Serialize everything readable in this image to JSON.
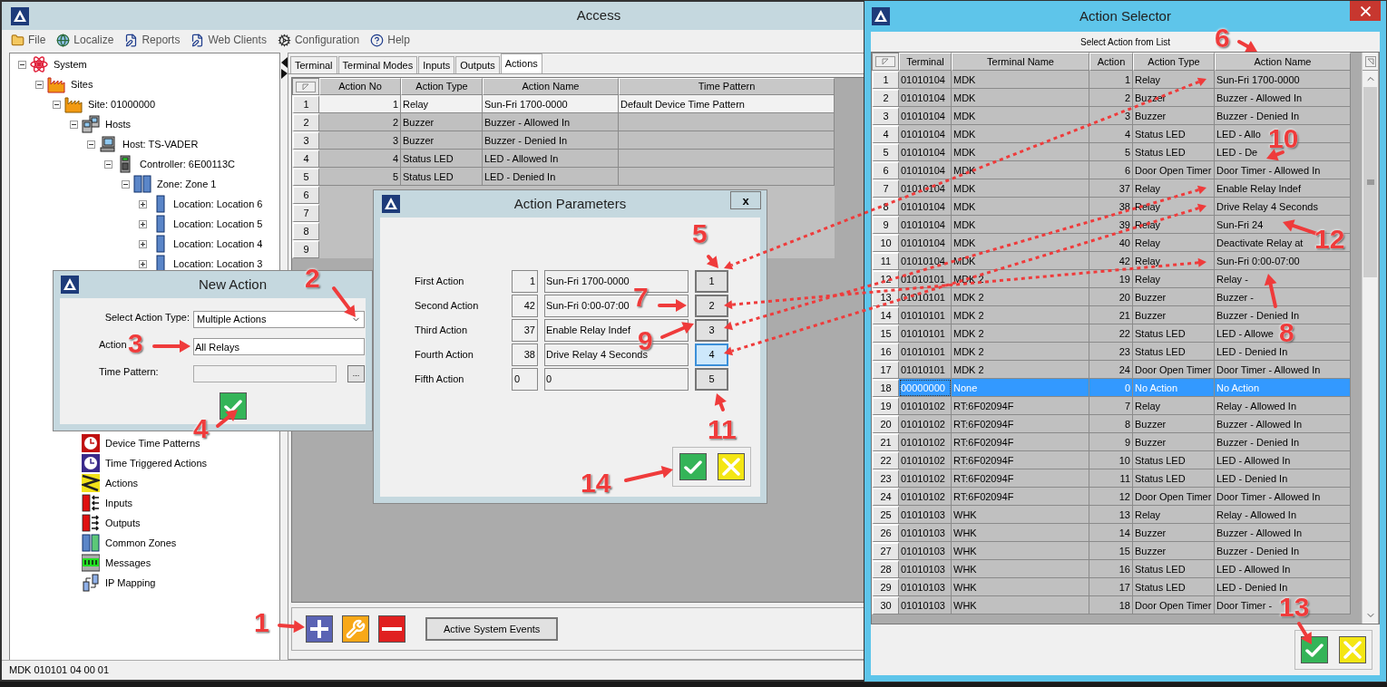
{
  "window": {
    "title": "Access"
  },
  "menu": [
    {
      "label": "File",
      "kind": "folder"
    },
    {
      "label": "Localize",
      "kind": "globe"
    },
    {
      "label": "Reports",
      "kind": "edit"
    },
    {
      "label": "Web Clients",
      "kind": "edit"
    },
    {
      "label": "Configuration",
      "kind": "gears"
    },
    {
      "label": "Help",
      "kind": "help"
    }
  ],
  "tree": [
    {
      "label": "System",
      "kind": "system",
      "expanded": true,
      "children": [
        {
          "label": "Sites",
          "kind": "sites",
          "expanded": true,
          "children": [
            {
              "label": "Site: 01000000",
              "kind": "site",
              "expanded": true,
              "children": [
                {
                  "label": "Hosts",
                  "kind": "hosts",
                  "expanded": true,
                  "children": [
                    {
                      "label": "Host: TS-VADER",
                      "kind": "host",
                      "expanded": true,
                      "children": [
                        {
                          "label": "Controller: 6E00113C",
                          "kind": "controller",
                          "expanded": true,
                          "children": [
                            {
                              "label": "Zone: Zone 1",
                              "kind": "zone",
                              "expanded": true,
                              "children": [
                                {
                                  "label": "Location: Location 6",
                                  "kind": "location",
                                  "expanded": false
                                },
                                {
                                  "label": "Location: Location 5",
                                  "kind": "location",
                                  "expanded": false
                                },
                                {
                                  "label": "Location: Location 4",
                                  "kind": "location",
                                  "expanded": false
                                },
                                {
                                  "label": "Location: Location 3",
                                  "kind": "location",
                                  "expanded": false
                                }
                              ]
                            }
                          ]
                        }
                      ]
                    }
                  ]
                },
                {
                  "label": "Device Time Patterns",
                  "kind": "schedule"
                },
                {
                  "label": "Time Triggered Actions",
                  "kind": "timer"
                },
                {
                  "label": "Actions",
                  "kind": "actions"
                },
                {
                  "label": "Inputs",
                  "kind": "inputs"
                },
                {
                  "label": "Outputs",
                  "kind": "outputs"
                },
                {
                  "label": "Common Zones",
                  "kind": "zones"
                },
                {
                  "label": "Messages",
                  "kind": "messages"
                },
                {
                  "label": "IP Mapping",
                  "kind": "mapping"
                }
              ]
            }
          ]
        }
      ]
    }
  ],
  "tabs": [
    {
      "label": "Terminal",
      "selected": false
    },
    {
      "label": "Terminal Modes",
      "selected": false
    },
    {
      "label": "Inputs",
      "selected": false
    },
    {
      "label": "Outputs",
      "selected": false
    },
    {
      "label": "Actions",
      "selected": true
    }
  ],
  "actions_table": {
    "columns": [
      "Action No",
      "Action Type",
      "Action Name",
      "Time Pattern"
    ],
    "rows": [
      {
        "no": "1",
        "selected": true,
        "cells": [
          "1",
          "Relay",
          "Sun-Fri 1700-0000",
          "Default Device Time Pattern"
        ]
      },
      {
        "no": "2",
        "selected": false,
        "cells": [
          "2",
          "Buzzer",
          "Buzzer - Allowed In"
        ]
      },
      {
        "no": "3",
        "selected": false,
        "cells": [
          "3",
          "Buzzer",
          "Buzzer - Denied In"
        ]
      },
      {
        "no": "4",
        "selected": false,
        "cells": [
          "4",
          "Status LED",
          "LED - Allowed In"
        ]
      },
      {
        "no": "5",
        "selected": false,
        "cells": [
          "5",
          "Status LED",
          "LED - Denied In"
        ]
      },
      {
        "no": "6",
        "selected": false
      },
      {
        "no": "7",
        "selected": false
      },
      {
        "no": "8",
        "selected": false
      },
      {
        "no": "9",
        "selected": false
      }
    ]
  },
  "toolbar": {
    "events_button": "Active System Events"
  },
  "status_bar": "MDK 010101 04 00 01",
  "new_action": {
    "title": "New Action",
    "type_label": "Select Action Type:",
    "type_value": "Multiple Actions",
    "name_label": "Action",
    "name_value": "All Relays",
    "pattern_label": "Time Pattern:",
    "browse": "..."
  },
  "action_parameters": {
    "title": "Action Parameters",
    "close": "x",
    "slots": [
      {
        "label": "First Action",
        "number": "1",
        "name": "Sun-Fri 1700-0000",
        "button": "1",
        "selected": false
      },
      {
        "label": "Second Action",
        "number": "42",
        "name": "Sun-Fri 0:00-07:00",
        "button": "2",
        "selected": false
      },
      {
        "label": "Third Action",
        "number": "37",
        "name": "Enable Relay Indef",
        "button": "3",
        "selected": false
      },
      {
        "label": "Fourth Action",
        "number": "38",
        "name": "Drive Relay 4 Seconds",
        "button": "4",
        "selected": true
      },
      {
        "label": "Fifth Action",
        "number": "0",
        "name": "0",
        "button": "5",
        "selected": false
      }
    ]
  },
  "action_selector": {
    "title": "Action Selector",
    "subtitle": "Select Action from List",
    "columns": [
      "Terminal",
      "Terminal Name",
      "Action",
      "Action Type",
      "Action Name"
    ],
    "rows": [
      {
        "no": "1",
        "selected": false,
        "cells": [
          "01010104",
          "MDK",
          "1",
          "Relay",
          "Sun-Fri 1700-0000"
        ]
      },
      {
        "no": "2",
        "selected": false,
        "cells": [
          "01010104",
          "MDK",
          "2",
          "Buzzer",
          "Buzzer - Allowed In"
        ]
      },
      {
        "no": "3",
        "selected": false,
        "cells": [
          "01010104",
          "MDK",
          "3",
          "Buzzer",
          "Buzzer - Denied In"
        ]
      },
      {
        "no": "4",
        "selected": false,
        "cells": [
          "01010104",
          "MDK",
          "4",
          "Status LED",
          "LED - Allo"
        ]
      },
      {
        "no": "5",
        "selected": false,
        "cells": [
          "01010104",
          "MDK",
          "5",
          "Status LED",
          "LED - De"
        ]
      },
      {
        "no": "6",
        "selected": false,
        "cells": [
          "01010104",
          "MDK",
          "6",
          "Door Open Timer",
          "Door Timer - Allowed In"
        ]
      },
      {
        "no": "7",
        "selected": false,
        "cells": [
          "01010104",
          "MDK",
          "37",
          "Relay",
          "Enable Relay Indef"
        ]
      },
      {
        "no": "8",
        "selected": false,
        "cells": [
          "01010104",
          "MDK",
          "38",
          "Relay",
          "Drive Relay 4 Seconds"
        ]
      },
      {
        "no": "9",
        "selected": false,
        "cells": [
          "01010104",
          "MDK",
          "39",
          "Relay",
          "Sun-Fri 24"
        ]
      },
      {
        "no": "10",
        "selected": false,
        "cells": [
          "01010104",
          "MDK",
          "40",
          "Relay",
          "Deactivate Relay at"
        ]
      },
      {
        "no": "11",
        "selected": false,
        "cells": [
          "01010104",
          "MDK",
          "42",
          "Relay",
          "Sun-Fri 0:00-07:00"
        ]
      },
      {
        "no": "12",
        "selected": false,
        "cells": [
          "01010101",
          "MDK 2",
          "19",
          "Relay",
          "Relay -"
        ]
      },
      {
        "no": "13",
        "selected": false,
        "cells": [
          "01010101",
          "MDK 2",
          "20",
          "Buzzer",
          "Buzzer -"
        ]
      },
      {
        "no": "14",
        "selected": false,
        "cells": [
          "01010101",
          "MDK 2",
          "21",
          "Buzzer",
          "Buzzer - Denied In"
        ]
      },
      {
        "no": "15",
        "selected": false,
        "cells": [
          "01010101",
          "MDK 2",
          "22",
          "Status LED",
          "LED - Allowe"
        ]
      },
      {
        "no": "16",
        "selected": false,
        "cells": [
          "01010101",
          "MDK 2",
          "23",
          "Status LED",
          "LED - Denied In"
        ]
      },
      {
        "no": "17",
        "selected": false,
        "cells": [
          "01010101",
          "MDK 2",
          "24",
          "Door Open Timer",
          "Door Timer - Allowed In"
        ]
      },
      {
        "no": "18",
        "selected": true,
        "cells": [
          "00000000",
          "None",
          "0",
          "No Action",
          "No Action"
        ]
      },
      {
        "no": "19",
        "selected": false,
        "cells": [
          "01010102",
          "RT:6F02094F",
          "7",
          "Relay",
          "Relay - Allowed In"
        ]
      },
      {
        "no": "20",
        "selected": false,
        "cells": [
          "01010102",
          "RT:6F02094F",
          "8",
          "Buzzer",
          "Buzzer - Allowed In"
        ]
      },
      {
        "no": "21",
        "selected": false,
        "cells": [
          "01010102",
          "RT:6F02094F",
          "9",
          "Buzzer",
          "Buzzer - Denied In"
        ]
      },
      {
        "no": "22",
        "selected": false,
        "cells": [
          "01010102",
          "RT:6F02094F",
          "10",
          "Status LED",
          "LED - Allowed In"
        ]
      },
      {
        "no": "23",
        "selected": false,
        "cells": [
          "01010102",
          "RT:6F02094F",
          "11",
          "Status LED",
          "LED - Denied In"
        ]
      },
      {
        "no": "24",
        "selected": false,
        "cells": [
          "01010102",
          "RT:6F02094F",
          "12",
          "Door Open Timer",
          "Door Timer - Allowed In"
        ]
      },
      {
        "no": "25",
        "selected": false,
        "cells": [
          "01010103",
          "WHK",
          "13",
          "Relay",
          "Relay - Allowed In"
        ]
      },
      {
        "no": "26",
        "selected": false,
        "cells": [
          "01010103",
          "WHK",
          "14",
          "Buzzer",
          "Buzzer - Allowed In"
        ]
      },
      {
        "no": "27",
        "selected": false,
        "cells": [
          "01010103",
          "WHK",
          "15",
          "Buzzer",
          "Buzzer - Denied In"
        ]
      },
      {
        "no": "28",
        "selected": false,
        "cells": [
          "01010103",
          "WHK",
          "16",
          "Status LED",
          "LED - Allowed In"
        ]
      },
      {
        "no": "29",
        "selected": false,
        "cells": [
          "01010103",
          "WHK",
          "17",
          "Status LED",
          "LED - Denied In"
        ]
      },
      {
        "no": "30",
        "selected": false,
        "cells": [
          "01010103",
          "WHK",
          "18",
          "Door Open Timer",
          "Door Timer -"
        ]
      }
    ]
  },
  "callouts": [
    "1",
    "2",
    "3",
    "4",
    "5",
    "6",
    "7",
    "8",
    "9",
    "10",
    "11",
    "12",
    "13",
    "14"
  ]
}
